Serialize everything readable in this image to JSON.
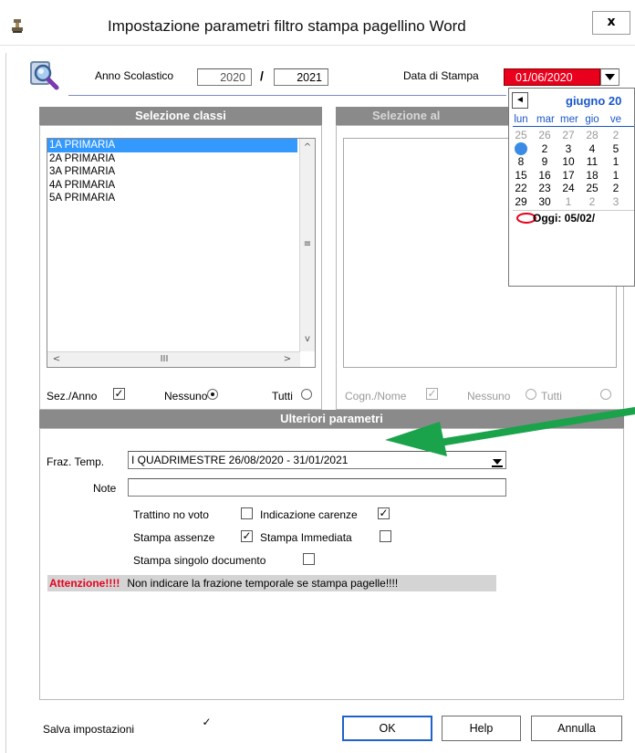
{
  "window": {
    "title": "Impostazione parametri filtro stampa pagellino Word",
    "close_label": "x"
  },
  "header": {
    "anno_label": "Anno Scolastico",
    "anno_start": "2020",
    "anno_sep": "/",
    "anno_end": "2021",
    "data_label": "Data di Stampa",
    "data_value": "01/06/2020"
  },
  "calendar": {
    "prev_label": "◄",
    "month_label": "giugno 20",
    "day_names": [
      "lun",
      "mar",
      "mer",
      "gio",
      "ve"
    ],
    "weeks": [
      [
        "25",
        "26",
        "27",
        "28",
        "2"
      ],
      [
        "1",
        "2",
        "3",
        "4",
        "5"
      ],
      [
        "8",
        "9",
        "10",
        "11",
        "1"
      ],
      [
        "15",
        "16",
        "17",
        "18",
        "1"
      ],
      [
        "22",
        "23",
        "24",
        "25",
        "2"
      ],
      [
        "29",
        "30",
        "1",
        "2",
        "3"
      ]
    ],
    "today_label": "Oggi: 05/02/"
  },
  "classes": {
    "title": "Selezione classi",
    "items": [
      "1A PRIMARIA",
      "2A PRIMARIA",
      "3A PRIMARIA",
      "4A PRIMARIA",
      "5A PRIMARIA"
    ],
    "selected": "1A PRIMARIA",
    "sez_label": "Sez./Anno",
    "nessuno_label": "Nessuno",
    "tutti_label": "Tutti"
  },
  "students": {
    "title": "Selezione al",
    "cogn_label": "Cogn./Nome",
    "nessuno_label": "Nessuno",
    "tutti_label": "Tutti"
  },
  "params": {
    "title": "Ulteriori parametri",
    "fraz_label": "Fraz. Temp.",
    "fraz_value": "I QUADRIMESTRE 26/08/2020 - 31/01/2021",
    "note_label": "Note",
    "note_value": "",
    "trattino_label": "Trattino no voto",
    "carenze_label": "Indicazione carenze",
    "assenze_label": "Stampa assenze",
    "immediata_label": "Stampa Immediata",
    "singolo_label": "Stampa singolo documento",
    "attn_label": "Attenzione!!!!",
    "attn_text": "Non indicare la frazione temporale se stampa pagelle!!!!"
  },
  "footer": {
    "salva_label": "Salva impostazioni",
    "ok_label": "OK",
    "help_label": "Help",
    "annulla_label": "Annulla"
  },
  "colors": {
    "date_field_bg": "#e8001c",
    "calendar_accent": "#1a57c9",
    "section_bar": "#8a8a8a",
    "selection": "#3399ff",
    "annotation_arrow": "#1aa34a",
    "warning_red": "#e8001c"
  },
  "icons": {
    "app": "stamp-icon",
    "search": "magnifier-icon"
  }
}
